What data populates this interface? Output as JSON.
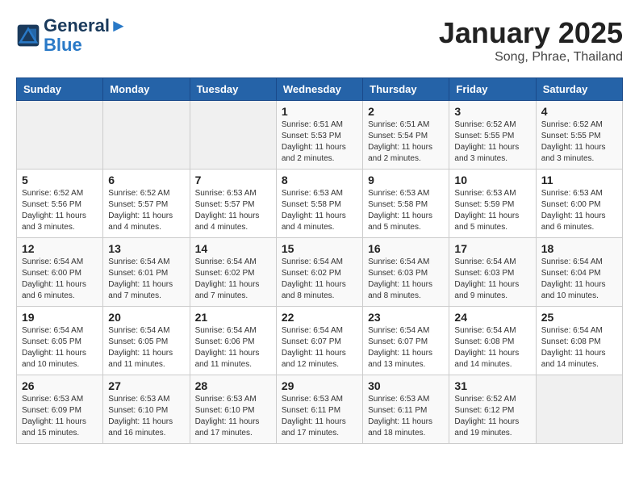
{
  "header": {
    "logo_line1": "General",
    "logo_line2": "Blue",
    "title": "January 2025",
    "subtitle": "Song, Phrae, Thailand"
  },
  "days_of_week": [
    "Sunday",
    "Monday",
    "Tuesday",
    "Wednesday",
    "Thursday",
    "Friday",
    "Saturday"
  ],
  "weeks": [
    [
      {
        "num": "",
        "detail": "",
        "empty": true
      },
      {
        "num": "",
        "detail": "",
        "empty": true
      },
      {
        "num": "",
        "detail": "",
        "empty": true
      },
      {
        "num": "1",
        "detail": "Sunrise: 6:51 AM\nSunset: 5:53 PM\nDaylight: 11 hours\nand 2 minutes."
      },
      {
        "num": "2",
        "detail": "Sunrise: 6:51 AM\nSunset: 5:54 PM\nDaylight: 11 hours\nand 2 minutes."
      },
      {
        "num": "3",
        "detail": "Sunrise: 6:52 AM\nSunset: 5:55 PM\nDaylight: 11 hours\nand 3 minutes."
      },
      {
        "num": "4",
        "detail": "Sunrise: 6:52 AM\nSunset: 5:55 PM\nDaylight: 11 hours\nand 3 minutes."
      }
    ],
    [
      {
        "num": "5",
        "detail": "Sunrise: 6:52 AM\nSunset: 5:56 PM\nDaylight: 11 hours\nand 3 minutes."
      },
      {
        "num": "6",
        "detail": "Sunrise: 6:52 AM\nSunset: 5:57 PM\nDaylight: 11 hours\nand 4 minutes."
      },
      {
        "num": "7",
        "detail": "Sunrise: 6:53 AM\nSunset: 5:57 PM\nDaylight: 11 hours\nand 4 minutes."
      },
      {
        "num": "8",
        "detail": "Sunrise: 6:53 AM\nSunset: 5:58 PM\nDaylight: 11 hours\nand 4 minutes."
      },
      {
        "num": "9",
        "detail": "Sunrise: 6:53 AM\nSunset: 5:58 PM\nDaylight: 11 hours\nand 5 minutes."
      },
      {
        "num": "10",
        "detail": "Sunrise: 6:53 AM\nSunset: 5:59 PM\nDaylight: 11 hours\nand 5 minutes."
      },
      {
        "num": "11",
        "detail": "Sunrise: 6:53 AM\nSunset: 6:00 PM\nDaylight: 11 hours\nand 6 minutes."
      }
    ],
    [
      {
        "num": "12",
        "detail": "Sunrise: 6:54 AM\nSunset: 6:00 PM\nDaylight: 11 hours\nand 6 minutes."
      },
      {
        "num": "13",
        "detail": "Sunrise: 6:54 AM\nSunset: 6:01 PM\nDaylight: 11 hours\nand 7 minutes."
      },
      {
        "num": "14",
        "detail": "Sunrise: 6:54 AM\nSunset: 6:02 PM\nDaylight: 11 hours\nand 7 minutes."
      },
      {
        "num": "15",
        "detail": "Sunrise: 6:54 AM\nSunset: 6:02 PM\nDaylight: 11 hours\nand 8 minutes."
      },
      {
        "num": "16",
        "detail": "Sunrise: 6:54 AM\nSunset: 6:03 PM\nDaylight: 11 hours\nand 8 minutes."
      },
      {
        "num": "17",
        "detail": "Sunrise: 6:54 AM\nSunset: 6:03 PM\nDaylight: 11 hours\nand 9 minutes."
      },
      {
        "num": "18",
        "detail": "Sunrise: 6:54 AM\nSunset: 6:04 PM\nDaylight: 11 hours\nand 10 minutes."
      }
    ],
    [
      {
        "num": "19",
        "detail": "Sunrise: 6:54 AM\nSunset: 6:05 PM\nDaylight: 11 hours\nand 10 minutes."
      },
      {
        "num": "20",
        "detail": "Sunrise: 6:54 AM\nSunset: 6:05 PM\nDaylight: 11 hours\nand 11 minutes."
      },
      {
        "num": "21",
        "detail": "Sunrise: 6:54 AM\nSunset: 6:06 PM\nDaylight: 11 hours\nand 11 minutes."
      },
      {
        "num": "22",
        "detail": "Sunrise: 6:54 AM\nSunset: 6:07 PM\nDaylight: 11 hours\nand 12 minutes."
      },
      {
        "num": "23",
        "detail": "Sunrise: 6:54 AM\nSunset: 6:07 PM\nDaylight: 11 hours\nand 13 minutes."
      },
      {
        "num": "24",
        "detail": "Sunrise: 6:54 AM\nSunset: 6:08 PM\nDaylight: 11 hours\nand 14 minutes."
      },
      {
        "num": "25",
        "detail": "Sunrise: 6:54 AM\nSunset: 6:08 PM\nDaylight: 11 hours\nand 14 minutes."
      }
    ],
    [
      {
        "num": "26",
        "detail": "Sunrise: 6:53 AM\nSunset: 6:09 PM\nDaylight: 11 hours\nand 15 minutes."
      },
      {
        "num": "27",
        "detail": "Sunrise: 6:53 AM\nSunset: 6:10 PM\nDaylight: 11 hours\nand 16 minutes."
      },
      {
        "num": "28",
        "detail": "Sunrise: 6:53 AM\nSunset: 6:10 PM\nDaylight: 11 hours\nand 17 minutes."
      },
      {
        "num": "29",
        "detail": "Sunrise: 6:53 AM\nSunset: 6:11 PM\nDaylight: 11 hours\nand 17 minutes."
      },
      {
        "num": "30",
        "detail": "Sunrise: 6:53 AM\nSunset: 6:11 PM\nDaylight: 11 hours\nand 18 minutes."
      },
      {
        "num": "31",
        "detail": "Sunrise: 6:52 AM\nSunset: 6:12 PM\nDaylight: 11 hours\nand 19 minutes."
      },
      {
        "num": "",
        "detail": "",
        "empty": true
      }
    ]
  ]
}
